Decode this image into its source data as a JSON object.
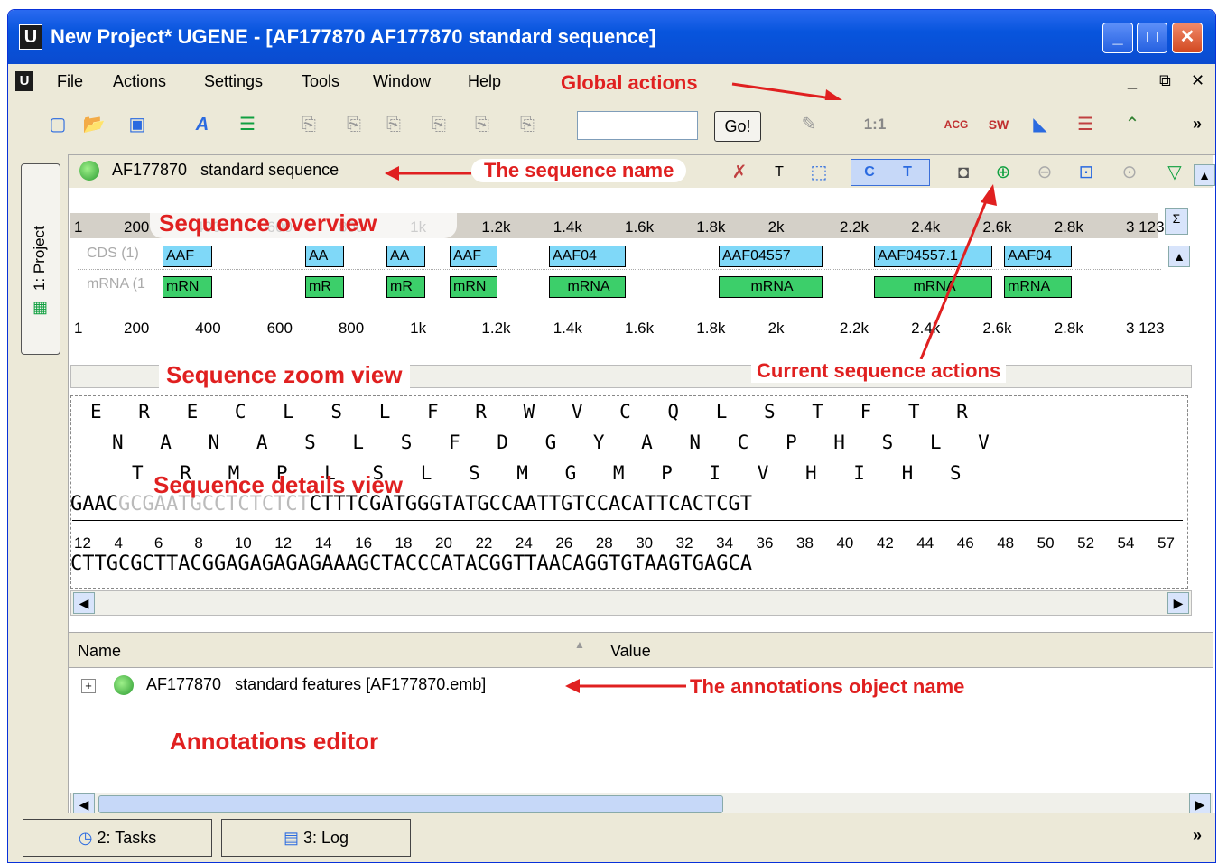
{
  "window": {
    "title": "New Project* UGENE - [AF177870 AF177870   standard sequence]",
    "app_icon": "U",
    "minimize": "_",
    "maximize": "□",
    "close": "✕"
  },
  "menu": {
    "items": [
      "File",
      "Actions",
      "Settings",
      "Tools",
      "Window",
      "Help"
    ],
    "annotation": "Global actions"
  },
  "toolbar": {
    "go_button": "Go!",
    "zoom_label": "1:1",
    "acg_label": "ACG",
    "sw_label": "SW",
    "overflow": "»"
  },
  "side_tab": {
    "label": "1: Project"
  },
  "sequence": {
    "name": "AF177870   standard sequence",
    "name_annotation": "The sequence name",
    "overview_annotation": "Sequence overview",
    "zoom_annotation": "Sequence zoom view",
    "details_annotation": "Sequence details view",
    "actions_annotation": "Current sequence actions"
  },
  "overview_ruler": {
    "start": "1",
    "ticks": [
      "200",
      "400",
      "600",
      "800",
      "1k",
      "1.2k",
      "1.4k",
      "1.6k",
      "1.8k",
      "2k",
      "2.2k",
      "2.4k",
      "2.6k",
      "2.8k",
      "3 123"
    ]
  },
  "zoom_view": {
    "track_labels": [
      "CDS (1)",
      "mRNA (1"
    ],
    "cds_features": [
      "AAF",
      "AA",
      "AA",
      "AAF",
      "AAF04",
      "AAF04557",
      "AAF04557.1",
      "AAF04"
    ],
    "mrna_features": [
      "mRN",
      "mR",
      "mR",
      "mRN",
      "mRNA",
      "mRNA",
      "mRNA",
      "mRNA"
    ],
    "ruler_start": "1",
    "ruler_ticks": [
      "200",
      "400",
      "600",
      "800",
      "1k",
      "1.2k",
      "1.4k",
      "1.6k",
      "1.8k",
      "2k",
      "2.2k",
      "2.4k",
      "2.6k",
      "2.8k",
      "3 123"
    ]
  },
  "details_view": {
    "frame1": "E R E C L S L F R W V C Q L S T F T R",
    "frame2": "N A N A S L S F D G Y A N C P H S L V",
    "frame3": "T R M P L S L S M G M P I V H I H S",
    "dna_top_a": "GAAC",
    "dna_top_b": "GCGAATGCCTCTCTCT",
    "dna_top_c": "CTTTCGATGGGTATGCCAATTGTCCACATTCACTCGT",
    "ruler": [
      "12",
      "4",
      "6",
      "8",
      "10",
      "12",
      "14",
      "16",
      "18",
      "20",
      "22",
      "24",
      "26",
      "28",
      "30",
      "32",
      "34",
      "36",
      "38",
      "40",
      "42",
      "44",
      "46",
      "48",
      "50",
      "52",
      "54",
      "57"
    ],
    "dna_bottom": "CTTGCGCTTACGGAGAGAGAGAAAGCTACCCATACGGTTAACAGGTGTAAGTGAGCA"
  },
  "annotations_editor": {
    "col_name": "Name",
    "col_value": "Value",
    "item": "AF177870   standard features [AF177870.emb]",
    "item_annotation": "The annotations object name",
    "editor_annotation": "Annotations editor"
  },
  "bottom_tabs": [
    "2: Tasks",
    "3: Log"
  ],
  "bottom_overflow": "»",
  "colors": {
    "title_bar": "#0a4bd0",
    "annotation": "#e02020",
    "cds": "#7fd8f8",
    "mrna": "#3ccf6a"
  }
}
